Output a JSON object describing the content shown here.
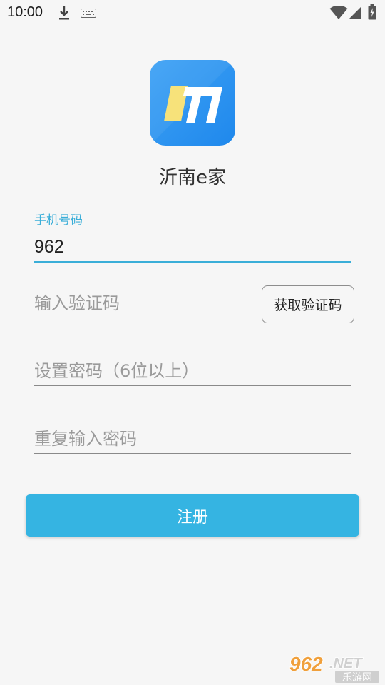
{
  "status_bar": {
    "time": "10:00",
    "icons": [
      "download-icon",
      "keyboard-icon",
      "wifi-icon",
      "signal-icon",
      "battery-icon"
    ]
  },
  "app": {
    "name": "沂南e家",
    "logo_icon": "app-logo-icon"
  },
  "form": {
    "phone_label": "手机号码",
    "phone_value": "962",
    "code_placeholder": "输入验证码",
    "get_code_label": "获取验证码",
    "password_placeholder": "设置密码（6位以上）",
    "confirm_placeholder": "重复输入密码",
    "register_label": "注册"
  },
  "watermark": {
    "brand": "962.NET",
    "sub": "乐游网"
  },
  "colors": {
    "accent": "#3aaed8",
    "button": "#35b4e2",
    "logo_blue": "#2a8ff0",
    "logo_yellow": "#f7e27a"
  }
}
